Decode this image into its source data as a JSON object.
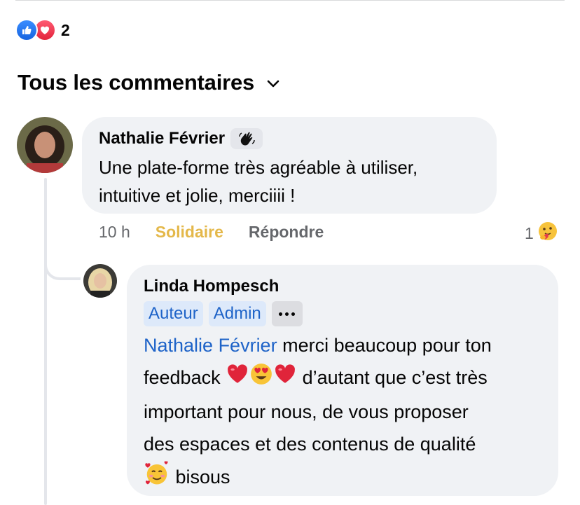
{
  "reactions": {
    "types": [
      "like-icon",
      "love-icon"
    ],
    "count": "2",
    "colors": {
      "like": "#1877f2",
      "love": "#f33e58"
    }
  },
  "comments_header": {
    "label": "Tous les commentaires"
  },
  "comment": {
    "author": "Nathalie Février",
    "badge_icon": "waving-hand-icon",
    "text_line1": "Une plate-forme très agréable à utiliser,",
    "text_line2": "intuitive et jolie, merciiii !",
    "time": "10 h",
    "react_label": "Solidaire",
    "reply_label": "Répondre",
    "reaction_count": "1",
    "reaction_icon": "care-hug-emoji-icon"
  },
  "reply": {
    "author": "Linda Hompesch",
    "tags": [
      "Auteur",
      "Admin"
    ],
    "more_icon": "more-options-icon",
    "mention": "Nathalie Février",
    "text_after_mention": " merci beaucoup pour ton",
    "text_line2_start": "feedback ",
    "text_line2_end": " d’autant que c’est très",
    "text_line3": "important pour nous, de vous proposer",
    "text_line4": "des espaces et des contenus de qualité",
    "text_line5_end": " bisous",
    "emojis": [
      "red-heart-icon",
      "heart-eyes-icon",
      "red-heart-icon",
      "smiling-face-with-hearts-icon"
    ]
  },
  "colors": {
    "link_blue": "#1e63c8",
    "solidaire_gold": "#e4b84a",
    "bubble_bg": "#f0f2f5",
    "meta_gray": "#65676b"
  }
}
